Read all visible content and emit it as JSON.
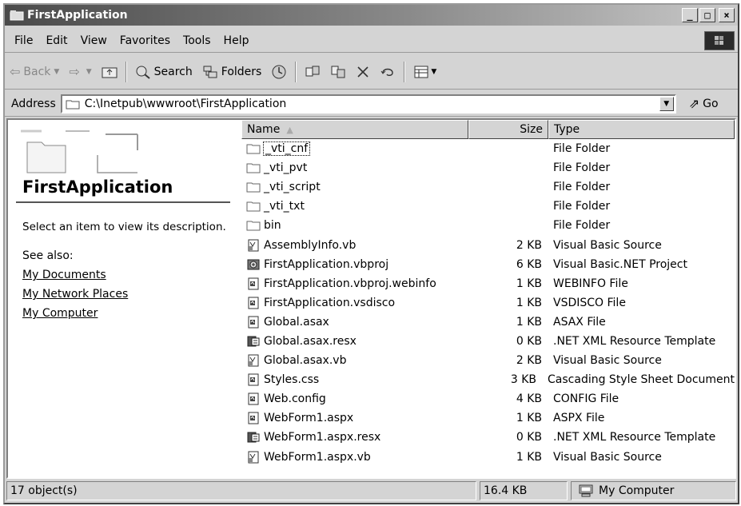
{
  "window": {
    "title": "FirstApplication",
    "minimize_label": "_",
    "maximize_label": "□",
    "close_label": "×"
  },
  "menubar": {
    "items": [
      "File",
      "Edit",
      "View",
      "Favorites",
      "Tools",
      "Help"
    ]
  },
  "toolbar": {
    "back_label": "Back",
    "search_label": "Search",
    "folders_label": "Folders"
  },
  "address": {
    "label": "Address",
    "value": "C:\\Inetpub\\wwwroot\\FirstApplication",
    "go_label": "Go"
  },
  "left_pane": {
    "title": "FirstApplication",
    "description": "Select an item to view its description.",
    "see_also_label": "See also:",
    "links": [
      "My Documents",
      "My Network Places",
      "My Computer"
    ]
  },
  "list": {
    "columns": {
      "name": "Name",
      "size": "Size",
      "type": "Type"
    },
    "rows": [
      {
        "name": "_vti_cnf",
        "size": "",
        "type": "File Folder",
        "icon": "folder-icon"
      },
      {
        "name": "_vti_pvt",
        "size": "",
        "type": "File Folder",
        "icon": "folder-icon"
      },
      {
        "name": "_vti_script",
        "size": "",
        "type": "File Folder",
        "icon": "folder-icon"
      },
      {
        "name": "_vti_txt",
        "size": "",
        "type": "File Folder",
        "icon": "folder-icon"
      },
      {
        "name": "bin",
        "size": "",
        "type": "File Folder",
        "icon": "folder-icon"
      },
      {
        "name": "AssemblyInfo.vb",
        "size": "2 KB",
        "type": "Visual Basic Source",
        "icon": "vb-source-icon"
      },
      {
        "name": "FirstApplication.vbproj",
        "size": "6 KB",
        "type": "Visual Basic.NET Project",
        "icon": "vb-project-icon"
      },
      {
        "name": "FirstApplication.vbproj.webinfo",
        "size": "1 KB",
        "type": "WEBINFO File",
        "icon": "generic-file-icon"
      },
      {
        "name": "FirstApplication.vsdisco",
        "size": "1 KB",
        "type": "VSDISCO File",
        "icon": "generic-file-icon"
      },
      {
        "name": "Global.asax",
        "size": "1 KB",
        "type": "ASAX File",
        "icon": "generic-file-icon"
      },
      {
        "name": "Global.asax.resx",
        "size": "0 KB",
        "type": ".NET XML Resource Template",
        "icon": "resx-icon"
      },
      {
        "name": "Global.asax.vb",
        "size": "2 KB",
        "type": "Visual Basic Source",
        "icon": "vb-source-icon"
      },
      {
        "name": "Styles.css",
        "size": "3 KB",
        "type": "Cascading Style Sheet Document",
        "icon": "generic-file-icon"
      },
      {
        "name": "Web.config",
        "size": "4 KB",
        "type": "CONFIG File",
        "icon": "generic-file-icon"
      },
      {
        "name": "WebForm1.aspx",
        "size": "1 KB",
        "type": "ASPX File",
        "icon": "generic-file-icon"
      },
      {
        "name": "WebForm1.aspx.resx",
        "size": "0 KB",
        "type": ".NET XML Resource Template",
        "icon": "resx-icon"
      },
      {
        "name": "WebForm1.aspx.vb",
        "size": "1 KB",
        "type": "Visual Basic Source",
        "icon": "vb-source-icon"
      }
    ]
  },
  "statusbar": {
    "objects": "17 object(s)",
    "size": "16.4 KB",
    "zone": "My Computer"
  }
}
